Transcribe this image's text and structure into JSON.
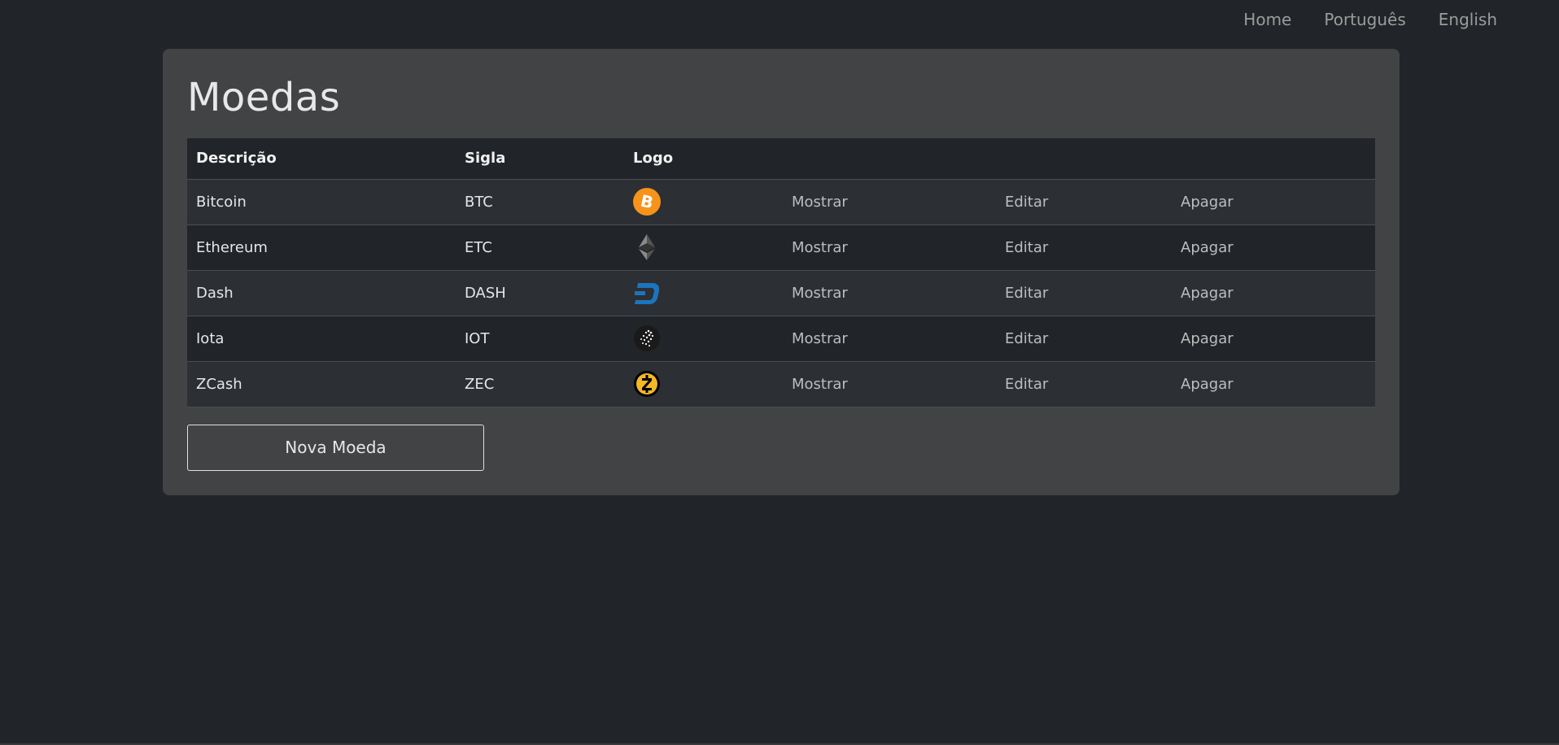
{
  "nav": {
    "home": "Home",
    "portuguese": "Português",
    "english": "English"
  },
  "page": {
    "title": "Moedas",
    "new_button": "Nova Moeda"
  },
  "table": {
    "headers": [
      "Descrição",
      "Sigla",
      "Logo"
    ],
    "rows": [
      {
        "name": "Bitcoin",
        "symbol": "BTC",
        "logo": "bitcoin-logo",
        "show": "Mostrar",
        "edit": "Editar",
        "delete": "Apagar"
      },
      {
        "name": "Ethereum",
        "symbol": "ETC",
        "logo": "ethereum-logo",
        "show": "Mostrar",
        "edit": "Editar",
        "delete": "Apagar"
      },
      {
        "name": "Dash",
        "symbol": "DASH",
        "logo": "dash-logo",
        "show": "Mostrar",
        "edit": "Editar",
        "delete": "Apagar"
      },
      {
        "name": "Iota",
        "symbol": "IOT",
        "logo": "iota-logo",
        "show": "Mostrar",
        "edit": "Editar",
        "delete": "Apagar"
      },
      {
        "name": "ZCash",
        "symbol": "ZEC",
        "logo": "zcash-logo",
        "show": "Mostrar",
        "edit": "Editar",
        "delete": "Apagar"
      }
    ]
  },
  "colors": {
    "bitcoin": "#f7931a",
    "dash": "#1c75bc",
    "zcash": "#f4b728"
  }
}
